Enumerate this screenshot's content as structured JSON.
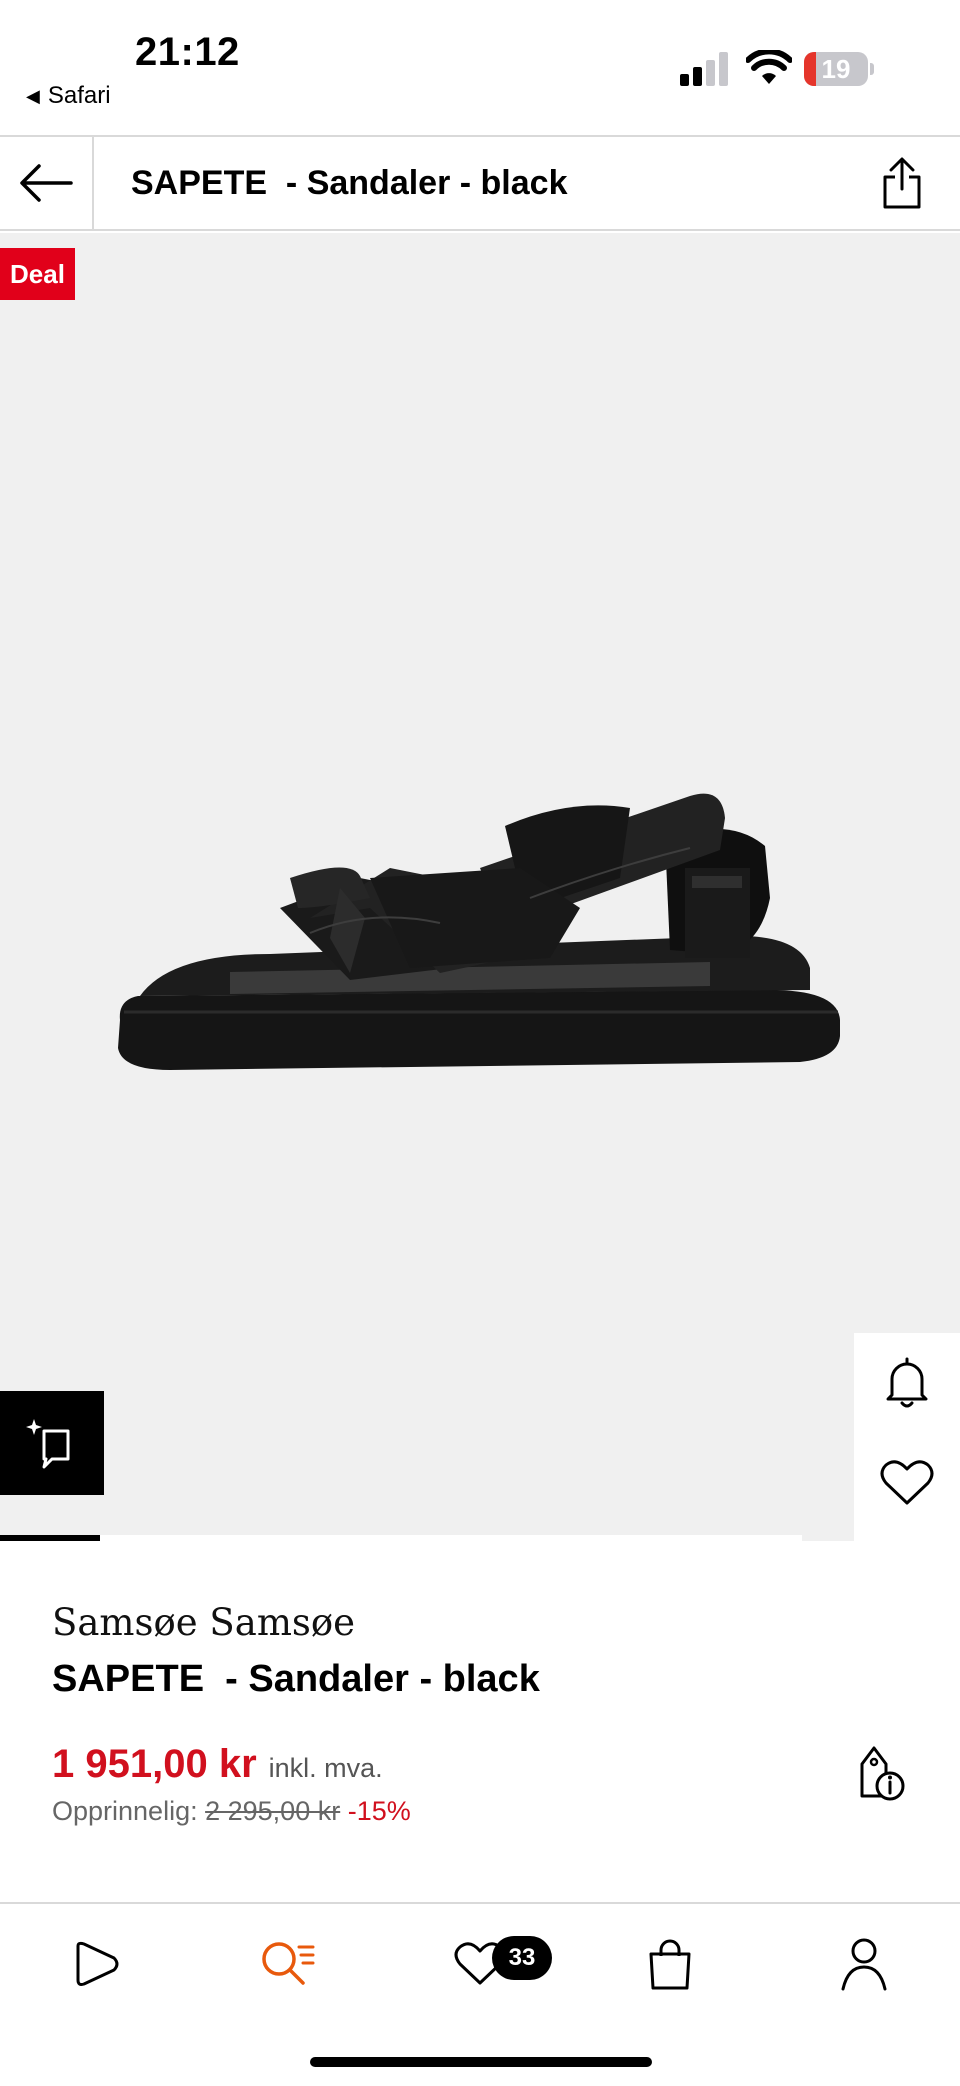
{
  "status_bar": {
    "time": "21:12",
    "back_app": "Safari",
    "battery_level": "19",
    "battery_fraction": 0.19
  },
  "header": {
    "title": "SAPETE  - Sandaler - black"
  },
  "gallery": {
    "deal_label": "Deal",
    "image_progress_fraction": 0.125
  },
  "product": {
    "brand": "Samsøe Samsøe",
    "title": "SAPETE  - Sandaler - black",
    "price": "1 951,00 kr",
    "vat_note": "inkl. mva.",
    "original_label": "Opprinnelig:",
    "original_price": "2 295,00 kr",
    "discount": "-15%"
  },
  "tabbar": {
    "wishlist_count": "33",
    "active_tab": "search",
    "active_color": "#e8590c"
  },
  "colors": {
    "price_red": "#d1101e",
    "deal_red": "#e1001a"
  }
}
